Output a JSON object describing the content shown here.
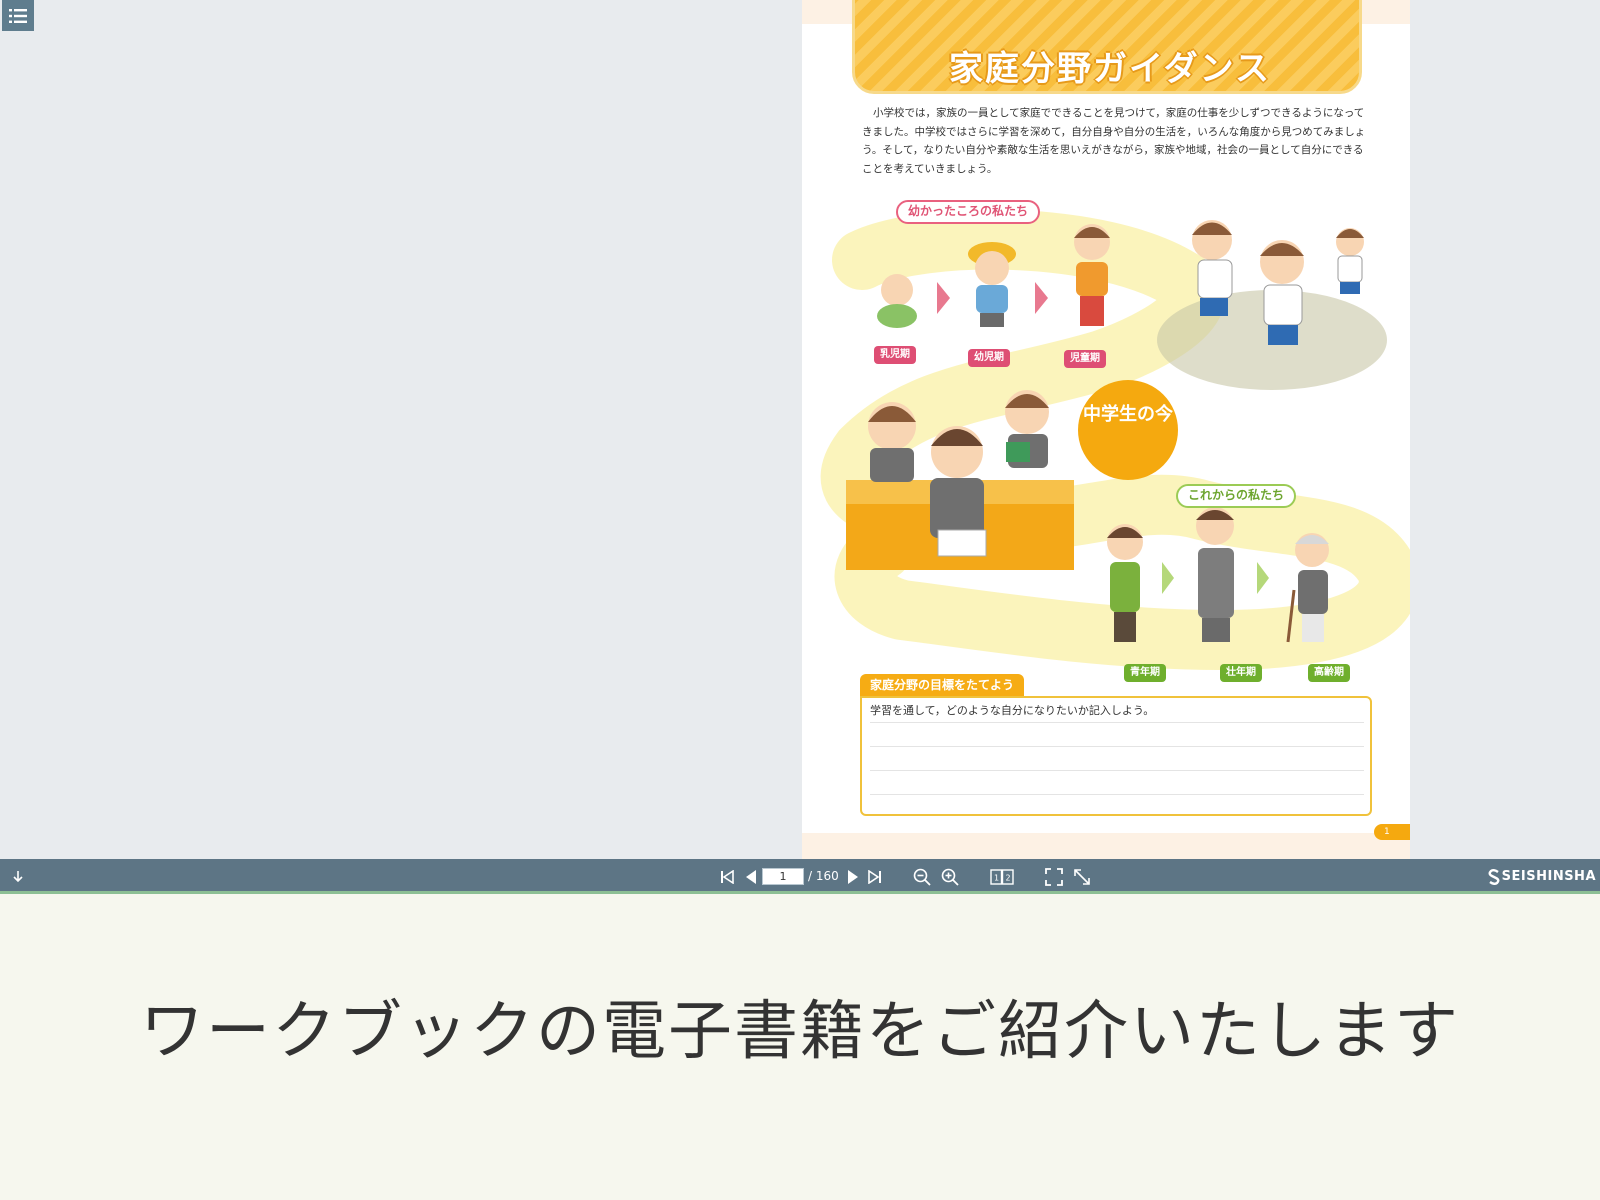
{
  "book": {
    "title": "家庭分野ガイダンス",
    "intro": "小学校では，家族の一員として家庭でできることを見つけて，家庭の仕事を少しずつできるようになってきました。中学校ではさらに学習を深めて，自分自身や自分の生活を，いろんな角度から見つめてみましょう。そして，なりたい自分や素敵な生活を思いえがきながら，家族や地域，社会の一員として自分にできることを考えていきましょう。",
    "past_label": "幼かったころの私たち",
    "past_stages": [
      "乳児期",
      "幼児期",
      "児童期"
    ],
    "now_label": "中学生の今",
    "future_label": "これからの私たち",
    "future_stages": [
      "青年期",
      "壮年期",
      "高齢期"
    ],
    "goal_header": "家庭分野の目標をたてよう",
    "goal_prompt": "学習を通して，どのような自分になりたいか記入しよう。",
    "page_number": "1"
  },
  "toolbar": {
    "current_page": "1",
    "total_pages": "/ 160",
    "brand": "SEISHINSHA",
    "icons": [
      "download-icon",
      "first-page-icon",
      "prev-page-icon",
      "next-page-icon",
      "last-page-icon",
      "zoom-out-icon",
      "zoom-in-icon",
      "spread-view-icon",
      "fullscreen-icon",
      "fit-window-icon"
    ]
  },
  "subtitle": "ワークブックの電子書籍をご紹介いたします",
  "colors": {
    "toolbar_bg": "#5d7585",
    "accent_orange": "#f5a90f",
    "accent_pink": "#e05475",
    "accent_green": "#6faf2d"
  }
}
